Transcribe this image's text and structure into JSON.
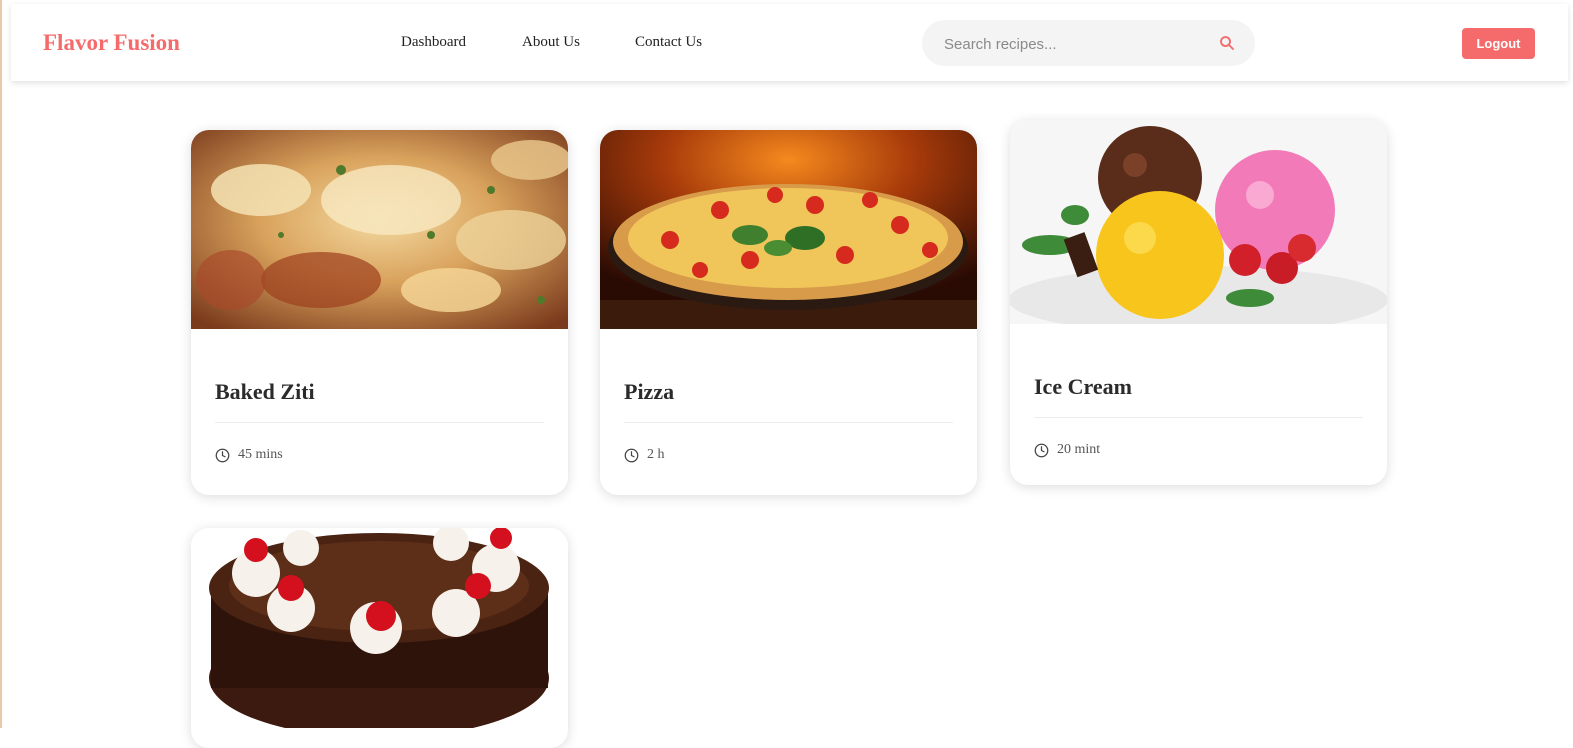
{
  "brand": "Flavor Fusion",
  "nav": {
    "links": [
      "Dashboard",
      "About Us",
      "Contact Us"
    ],
    "search_placeholder": "Search recipes...",
    "logout_label": "Logout"
  },
  "colors": {
    "accent": "#f56b6b"
  },
  "icons": {
    "search": "search-icon",
    "clock": "clock-icon"
  },
  "recipes": [
    {
      "title": "Baked Ziti",
      "time": "45 mins"
    },
    {
      "title": "Pizza",
      "time": "2 h"
    },
    {
      "title": "Ice Cream",
      "time": "20 mint"
    },
    {
      "title": "",
      "time": ""
    }
  ]
}
